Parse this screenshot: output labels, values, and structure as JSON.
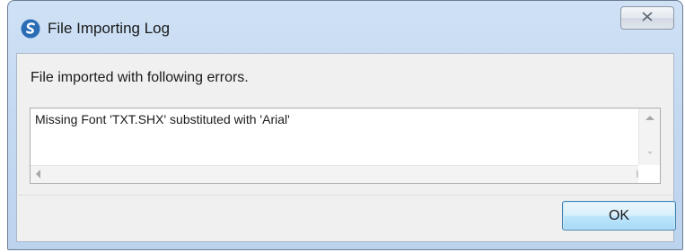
{
  "window": {
    "title": "File Importing Log",
    "app_icon": "blue-s-logo-icon",
    "close_icon": "close-icon"
  },
  "content": {
    "message": "File imported with following errors.",
    "log_entries": [
      "Missing Font 'TXT.SHX' substituted with 'Arial'"
    ]
  },
  "buttons": {
    "ok_label": "OK"
  },
  "colors": {
    "title_bar": "#c4d9f1",
    "ok_button_border": "#3c7fb1",
    "app_icon": "#2a6db5"
  }
}
